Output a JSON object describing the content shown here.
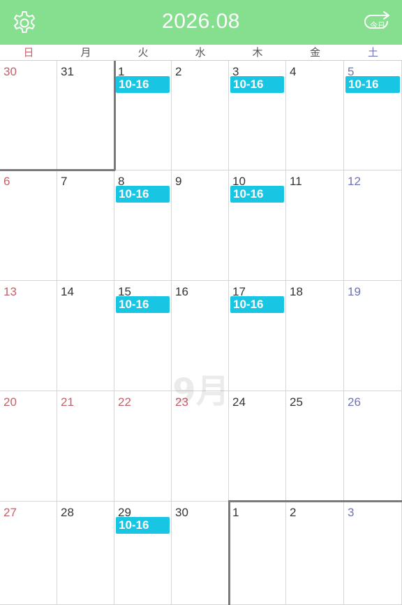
{
  "header": {
    "title": "2026.08",
    "today_label": "今日",
    "background": "#86df8e"
  },
  "weekdays": [
    "日",
    "月",
    "火",
    "水",
    "木",
    "金",
    "土"
  ],
  "watermark": "9月",
  "event_color": "#18c6e4",
  "weeks": [
    [
      {
        "day": "30",
        "kind": "sun",
        "event": ""
      },
      {
        "day": "31",
        "kind": "",
        "event": ""
      },
      {
        "day": "1",
        "kind": "",
        "event": "10-16"
      },
      {
        "day": "2",
        "kind": "",
        "event": ""
      },
      {
        "day": "3",
        "kind": "",
        "event": "10-16"
      },
      {
        "day": "4",
        "kind": "",
        "event": ""
      },
      {
        "day": "5",
        "kind": "sat",
        "event": "10-16"
      }
    ],
    [
      {
        "day": "6",
        "kind": "sun",
        "event": ""
      },
      {
        "day": "7",
        "kind": "",
        "event": ""
      },
      {
        "day": "8",
        "kind": "",
        "event": "10-16"
      },
      {
        "day": "9",
        "kind": "",
        "event": ""
      },
      {
        "day": "10",
        "kind": "",
        "event": "10-16"
      },
      {
        "day": "11",
        "kind": "",
        "event": ""
      },
      {
        "day": "12",
        "kind": "sat",
        "event": ""
      }
    ],
    [
      {
        "day": "13",
        "kind": "sun",
        "event": ""
      },
      {
        "day": "14",
        "kind": "",
        "event": ""
      },
      {
        "day": "15",
        "kind": "",
        "event": "10-16"
      },
      {
        "day": "16",
        "kind": "",
        "event": ""
      },
      {
        "day": "17",
        "kind": "",
        "event": "10-16"
      },
      {
        "day": "18",
        "kind": "",
        "event": ""
      },
      {
        "day": "19",
        "kind": "sat",
        "event": ""
      }
    ],
    [
      {
        "day": "20",
        "kind": "sun",
        "event": ""
      },
      {
        "day": "21",
        "kind": "hol",
        "event": ""
      },
      {
        "day": "22",
        "kind": "hol",
        "event": ""
      },
      {
        "day": "23",
        "kind": "hol",
        "event": ""
      },
      {
        "day": "24",
        "kind": "",
        "event": ""
      },
      {
        "day": "25",
        "kind": "",
        "event": ""
      },
      {
        "day": "26",
        "kind": "sat",
        "event": ""
      }
    ],
    [
      {
        "day": "27",
        "kind": "sun",
        "event": ""
      },
      {
        "day": "28",
        "kind": "",
        "event": ""
      },
      {
        "day": "29",
        "kind": "",
        "event": "10-16"
      },
      {
        "day": "30",
        "kind": "",
        "event": ""
      },
      {
        "day": "1",
        "kind": "",
        "event": ""
      },
      {
        "day": "2",
        "kind": "",
        "event": ""
      },
      {
        "day": "3",
        "kind": "sat",
        "event": ""
      }
    ]
  ]
}
